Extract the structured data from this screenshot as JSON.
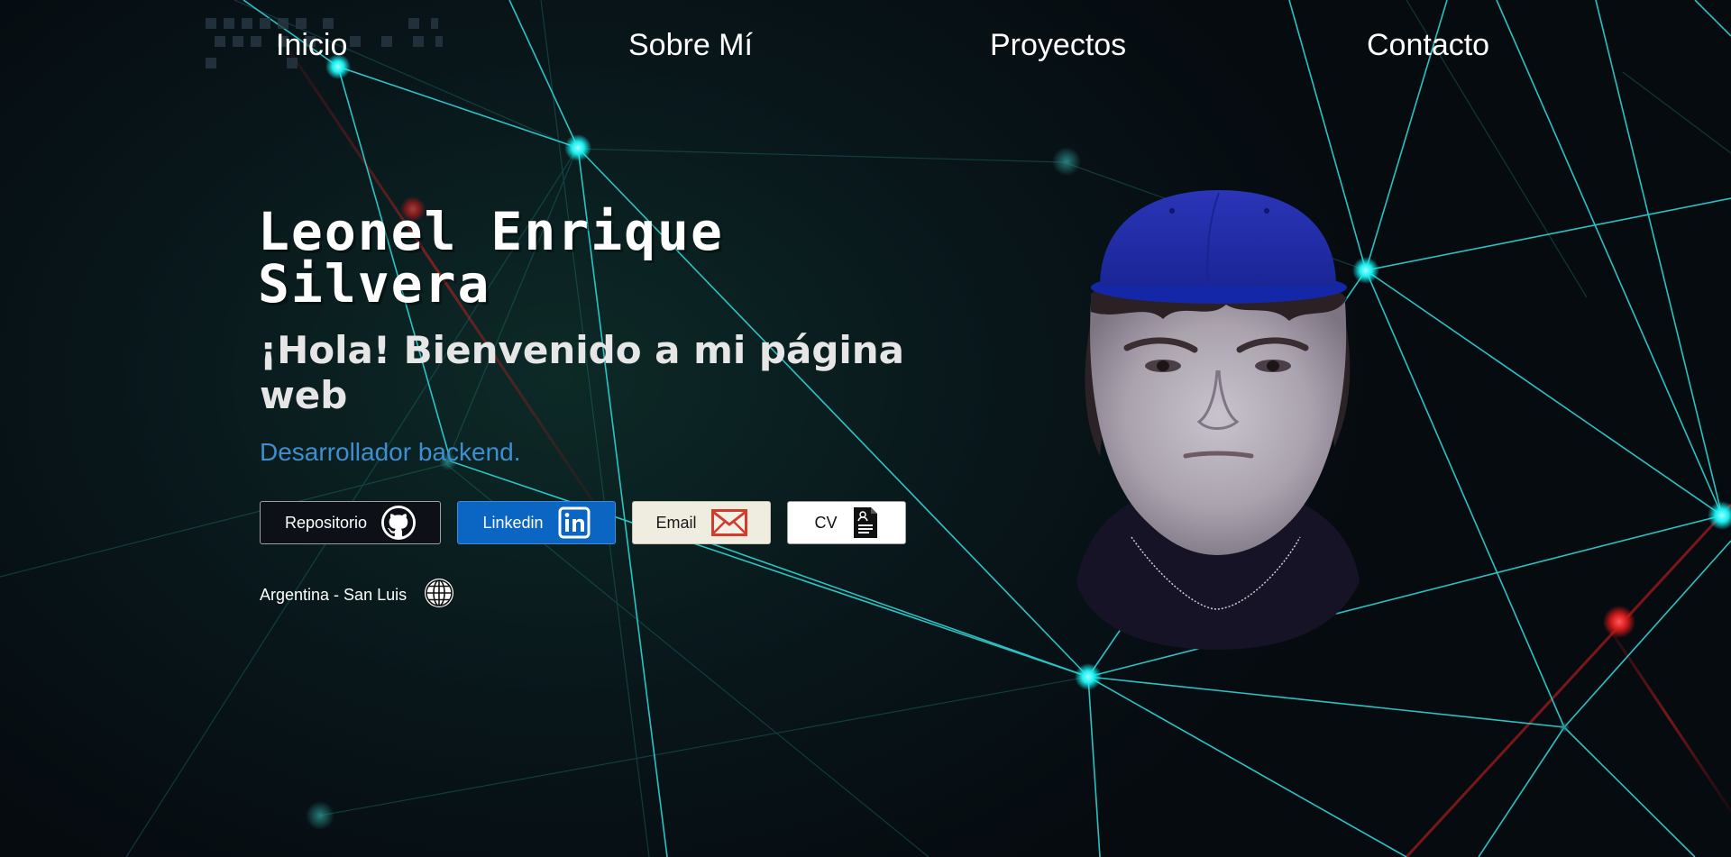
{
  "nav": {
    "items": [
      {
        "label": "Inicio"
      },
      {
        "label": "Sobre Mí"
      },
      {
        "label": "Proyectos"
      },
      {
        "label": "Contacto"
      }
    ]
  },
  "hero": {
    "name": "Leonel Enrique Silvera",
    "greeting": "¡Hola! Bienvenido a mi página web",
    "role": "Desarrollador backend.",
    "buttons": {
      "repo": {
        "label": "Repositorio",
        "icon": "github-icon"
      },
      "linkedin": {
        "label": "Linkedin",
        "icon": "linkedin-icon"
      },
      "email": {
        "label": "Email",
        "icon": "mail-icon"
      },
      "cv": {
        "label": "CV",
        "icon": "document-icon"
      }
    },
    "location": {
      "label": "Argentina - San Luis",
      "icon": "globe-icon"
    }
  },
  "colors": {
    "background": "#07110f",
    "network_line": "#2fd6d6",
    "network_node": "#19f0f0",
    "accent_red": "#e02020",
    "role_text": "#3d8fd0",
    "linkedin_blue": "#0a66c2",
    "github_dark": "#0d1117"
  }
}
